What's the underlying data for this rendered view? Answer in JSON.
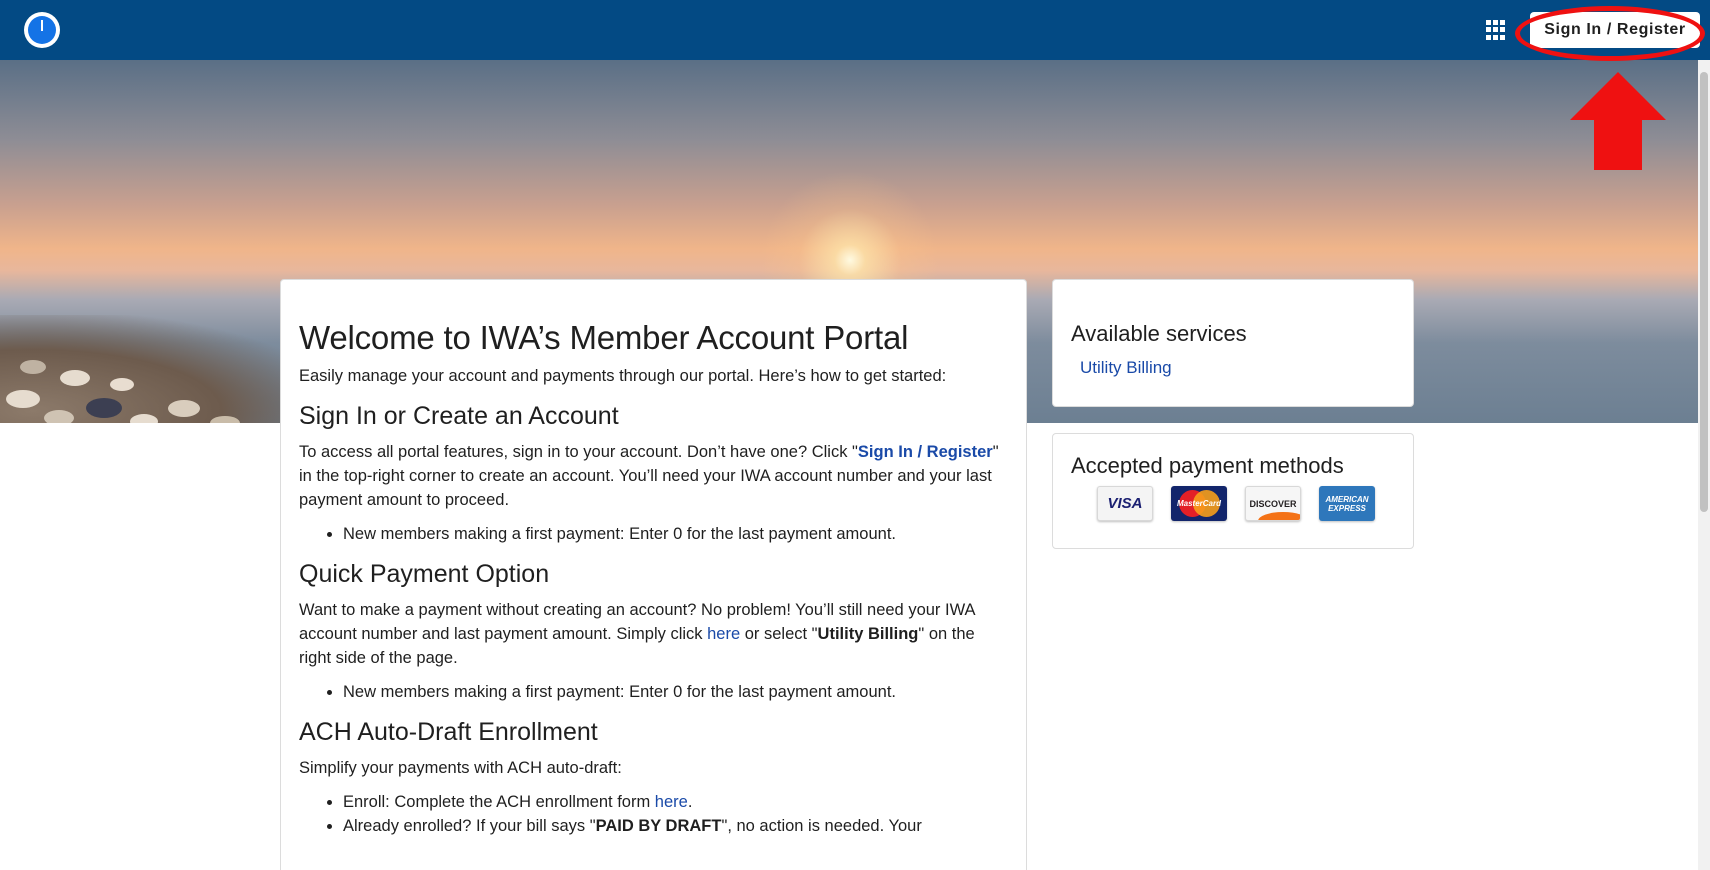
{
  "header": {
    "logo_icon": "compass-logo-icon",
    "apps_icon": "grid-apps-icon",
    "signin_label": "Sign In / Register",
    "bar_color": "#034a84"
  },
  "hero": {
    "description_icon": "beach-sunset-banner"
  },
  "main": {
    "title": "Welcome to IWA’s Member Account Portal",
    "intro": "Easily manage your account and payments through our portal. Here’s how to get started:",
    "section1": {
      "heading": "Sign In or Create an Account",
      "p_before": "To access all portal features, sign in to your account. Don’t have one? Click \"",
      "p_link": "Sign In / Register",
      "p_after": "\" in the top-right corner to create an account. You’ll need your IWA account number and your last payment amount to proceed.",
      "bullet": "New members making a first payment: Enter 0 for the last payment amount."
    },
    "section2": {
      "heading": "Quick Payment Option",
      "p_before": "Want to make a payment without creating an account? No problem! You’ll still need your IWA account number and last payment amount. Simply click ",
      "p_link": "here",
      "p_middle": " or select \"",
      "p_bold": "Utility Billing",
      "p_after": "\" on the right side of the page.",
      "bullet": "New members making a first payment: Enter 0 for the last payment amount."
    },
    "section3": {
      "heading": "ACH Auto-Draft Enrollment",
      "intro": "Simplify your payments with ACH auto-draft:",
      "bullet1_before": "Enroll: Complete the ACH enrollment form ",
      "bullet1_link": "here",
      "bullet1_after": ".",
      "bullet2_before": "Already enrolled? If your bill says \"",
      "bullet2_bold": "PAID BY DRAFT",
      "bullet2_after": "\", no action is needed. Your"
    }
  },
  "services": {
    "heading": "Available services",
    "link": "Utility Billing"
  },
  "payments": {
    "heading": "Accepted payment methods",
    "cards": [
      {
        "name": "visa",
        "label": "VISA"
      },
      {
        "name": "mastercard",
        "label": "MasterCard"
      },
      {
        "name": "discover",
        "label": "DISCOVER"
      },
      {
        "name": "amex",
        "label_line1": "AMERICAN",
        "label_line2": "EXPRESS"
      }
    ]
  },
  "annotation": {
    "color": "#ef1111",
    "arrow_icon": "red-up-arrow-icon",
    "ellipse_icon": "red-highlight-ellipse"
  }
}
